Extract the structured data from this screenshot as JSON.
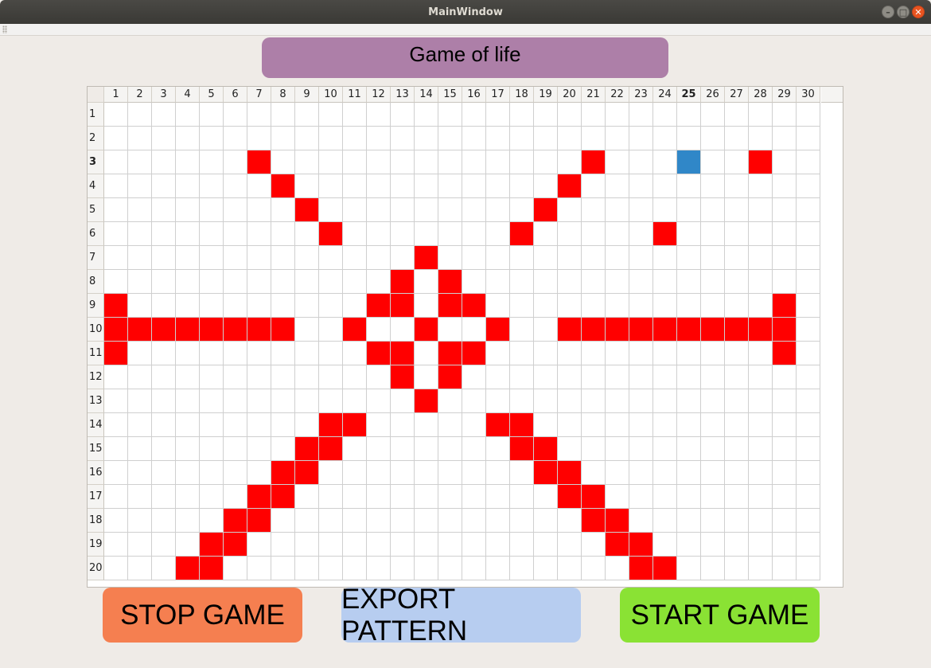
{
  "window": {
    "title": "MainWindow"
  },
  "header": {
    "title": "Game of life"
  },
  "table": {
    "columns": [
      "1",
      "2",
      "3",
      "4",
      "5",
      "6",
      "7",
      "8",
      "9",
      "10",
      "11",
      "12",
      "13",
      "14",
      "15",
      "16",
      "17",
      "18",
      "19",
      "20",
      "21",
      "22",
      "23",
      "24",
      "25",
      "26",
      "27",
      "28",
      "29",
      "30"
    ],
    "rows": [
      "1",
      "2",
      "3",
      "4",
      "5",
      "6",
      "7",
      "8",
      "9",
      "10",
      "11",
      "12",
      "13",
      "14",
      "15",
      "16",
      "17",
      "18",
      "19",
      "20"
    ],
    "current_column": "25",
    "current_row": "3",
    "selected_cell": {
      "row": 3,
      "col": 25
    },
    "alive_cells": [
      [
        3,
        7
      ],
      [
        3,
        21
      ],
      [
        3,
        28
      ],
      [
        4,
        8
      ],
      [
        4,
        20
      ],
      [
        5,
        9
      ],
      [
        5,
        19
      ],
      [
        6,
        10
      ],
      [
        6,
        18
      ],
      [
        6,
        24
      ],
      [
        7,
        14
      ],
      [
        8,
        13
      ],
      [
        8,
        15
      ],
      [
        9,
        1
      ],
      [
        9,
        12
      ],
      [
        9,
        13
      ],
      [
        9,
        15
      ],
      [
        9,
        16
      ],
      [
        9,
        29
      ],
      [
        10,
        1
      ],
      [
        10,
        2
      ],
      [
        10,
        3
      ],
      [
        10,
        4
      ],
      [
        10,
        5
      ],
      [
        10,
        6
      ],
      [
        10,
        7
      ],
      [
        10,
        8
      ],
      [
        10,
        11
      ],
      [
        10,
        14
      ],
      [
        10,
        17
      ],
      [
        10,
        20
      ],
      [
        10,
        21
      ],
      [
        10,
        22
      ],
      [
        10,
        23
      ],
      [
        10,
        24
      ],
      [
        10,
        25
      ],
      [
        10,
        26
      ],
      [
        10,
        27
      ],
      [
        10,
        28
      ],
      [
        10,
        29
      ],
      [
        11,
        1
      ],
      [
        11,
        12
      ],
      [
        11,
        13
      ],
      [
        11,
        15
      ],
      [
        11,
        16
      ],
      [
        11,
        29
      ],
      [
        12,
        13
      ],
      [
        12,
        15
      ],
      [
        13,
        14
      ],
      [
        14,
        10
      ],
      [
        14,
        11
      ],
      [
        14,
        17
      ],
      [
        14,
        18
      ],
      [
        15,
        9
      ],
      [
        15,
        10
      ],
      [
        15,
        18
      ],
      [
        15,
        19
      ],
      [
        16,
        8
      ],
      [
        16,
        9
      ],
      [
        16,
        19
      ],
      [
        16,
        20
      ],
      [
        17,
        7
      ],
      [
        17,
        8
      ],
      [
        17,
        20
      ],
      [
        17,
        21
      ],
      [
        18,
        6
      ],
      [
        18,
        7
      ],
      [
        18,
        21
      ],
      [
        18,
        22
      ],
      [
        19,
        5
      ],
      [
        19,
        6
      ],
      [
        19,
        22
      ],
      [
        19,
        23
      ],
      [
        20,
        4
      ],
      [
        20,
        5
      ],
      [
        20,
        23
      ],
      [
        20,
        24
      ]
    ],
    "colors": {
      "alive": "#ff0000",
      "selected": "#3087c8",
      "dead": "#ffffff"
    }
  },
  "buttons": {
    "stop": {
      "label": "STOP GAME",
      "color": "#f57f50"
    },
    "export": {
      "label": "EXPORT PATTERN",
      "color": "#b7cdf0"
    },
    "start": {
      "label": "START GAME",
      "color": "#8ae234"
    }
  }
}
